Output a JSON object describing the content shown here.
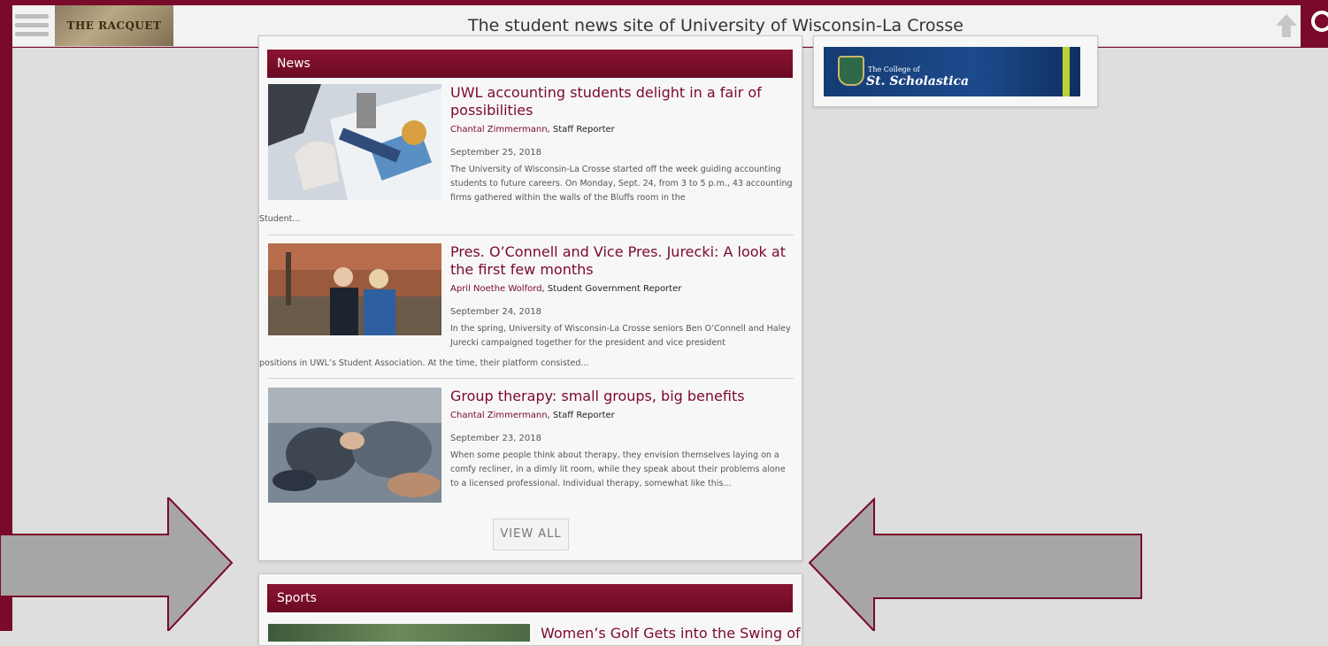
{
  "header": {
    "logo_text": "THE RACQUET",
    "tagline": "The student news site of University of Wisconsin-La Crosse",
    "icons": [
      "menu-icon",
      "up-arrow-icon",
      "search-icon"
    ]
  },
  "colors": {
    "brand": "#7a0a2a",
    "panel": "#f7f7f7",
    "arrow": "#a6a6a6"
  },
  "news": {
    "title": "News",
    "stories": [
      {
        "headline": "UWL accounting students delight in a fair of possibilities",
        "author": "Chantal Zimmermann",
        "role": ", Staff Reporter",
        "date": "September 25, 2018",
        "excerpt": "The University of Wisconsin-La Crosse started off the week guiding accounting students to future careers. On Monday, Sept. 24, from 3 to 5 p.m., 43 accounting firms gathered within the walls of the Bluffs room in the",
        "excerpt_tail": "Student..."
      },
      {
        "headline": "Pres. O’Connell and Vice Pres. Jurecki: A look at the first few months",
        "author": "April Noethe Wolford",
        "role": ", Student Government Reporter",
        "date": "September 24, 2018",
        "excerpt": "In the spring, University of Wisconsin-La Crosse seniors  Ben O’Connell and Haley Jurecki campaigned together for the president and vice president",
        "excerpt_tail": "positions in UWL’s Student Association. At the time, their platform consisted..."
      },
      {
        "headline": "Group therapy: small groups, big benefits",
        "author": "Chantal Zimmermann",
        "role": ", Staff Reporter",
        "date": "September 23, 2018",
        "excerpt": "When some people think about therapy, they envision themselves laying on a comfy recliner, in a dimly lit room, while they speak about their problems alone to a licensed professional. Individual therapy, somewhat like this...",
        "excerpt_tail": ""
      }
    ],
    "view_all": "VIEW ALL"
  },
  "sports": {
    "title": "Sports",
    "first_headline": "Women’s Golf Gets into the Swing of"
  },
  "ad": {
    "line1": "The College of",
    "line2": "St. Scholastica"
  }
}
